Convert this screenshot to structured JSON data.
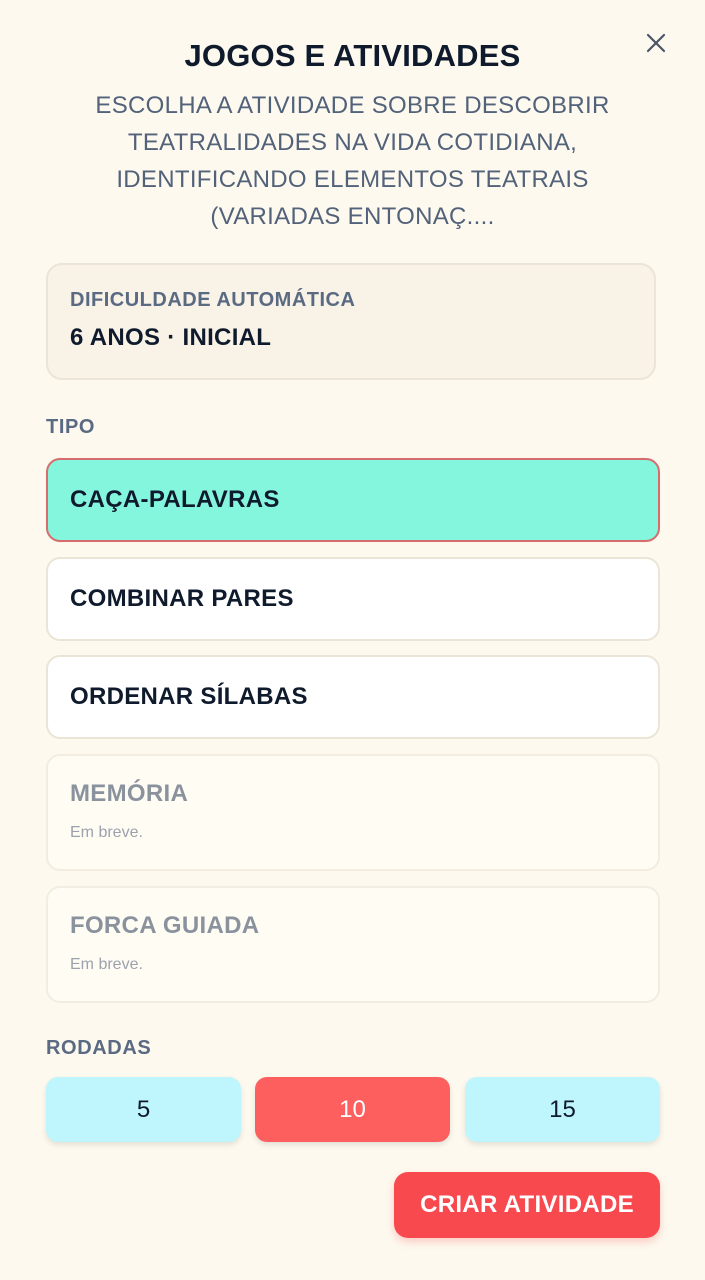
{
  "dialog": {
    "title": "JOGOS E ATIVIDADES",
    "subtitle": "ESCOLHA A ATIVIDADE SOBRE DESCOBRIR TEATRALIDADES NA VIDA COTIDIANA, IDENTIFICANDO ELEMENTOS TEATRAIS (VARIADAS ENTONAÇ....",
    "close_icon": "close-icon"
  },
  "difficulty": {
    "label": "DIFICULDADE AUTOMÁTICA",
    "value": "6 ANOS · INICIAL"
  },
  "type_section": {
    "label": "TIPO",
    "options": [
      {
        "label": "CAÇA-PALAVRAS",
        "selected": true,
        "enabled": true
      },
      {
        "label": "COMBINAR PARES",
        "selected": false,
        "enabled": true
      },
      {
        "label": "ORDENAR SÍLABAS",
        "selected": false,
        "enabled": true
      },
      {
        "label": "MEMÓRIA",
        "note": "Em breve.",
        "selected": false,
        "enabled": false
      },
      {
        "label": "FORCA GUIADA",
        "note": "Em breve.",
        "selected": false,
        "enabled": false
      }
    ]
  },
  "rounds_section": {
    "label": "RODADAS",
    "options": [
      {
        "label": "5",
        "selected": false
      },
      {
        "label": "10",
        "selected": true
      },
      {
        "label": "15",
        "selected": false
      }
    ]
  },
  "actions": {
    "create_label": "CRIAR ATIVIDADE"
  },
  "colors": {
    "background": "#fdf9ee",
    "selected_type": "#84f6de",
    "selected_round": "#fd5f5f",
    "round_idle": "#bff5fd",
    "primary_button": "#f8494f"
  }
}
